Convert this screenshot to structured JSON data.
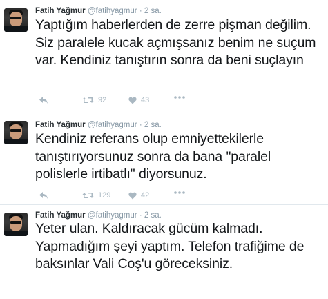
{
  "tweets": [
    {
      "name": "Fatih Yağmur",
      "handle": "@fatihyagmur",
      "dot": "·",
      "time": "2 sa.",
      "text": "Yaptığım haberlerden de zerre pişman değilim. Siz paralele kucak açmışsanız benim ne suçum var. Kendiniz tanıştırın sonra da beni suçlayın",
      "retweets": "92",
      "likes": "43"
    },
    {
      "name": "Fatih Yağmur",
      "handle": "@fatihyagmur",
      "dot": "·",
      "time": "2 sa.",
      "text": "Kendiniz referans olup emniyettekilerle tanıştırıyorsunuz sonra da bana \"paralel polislerle irtibatlı\" diyorsunuz.",
      "retweets": "129",
      "likes": "42"
    },
    {
      "name": "Fatih Yağmur",
      "handle": "@fatihyagmur",
      "dot": "·",
      "time": "2 sa.",
      "text": "Yeter ulan. Kaldıracak gücüm kalmadı. Yapmadığım şeyi yaptım. Telefon trafiğime de baksınlar Vali Coş'u göreceksiniz.",
      "retweets": "",
      "likes": ""
    }
  ],
  "icons": {
    "reply": "reply-icon",
    "retweet": "retweet-icon",
    "like": "heart-icon",
    "more": "more-icon"
  },
  "colors": {
    "text": "#14171a",
    "meta": "#8899a6",
    "action": "#aab8c2",
    "separator": "#e1e8ed"
  }
}
